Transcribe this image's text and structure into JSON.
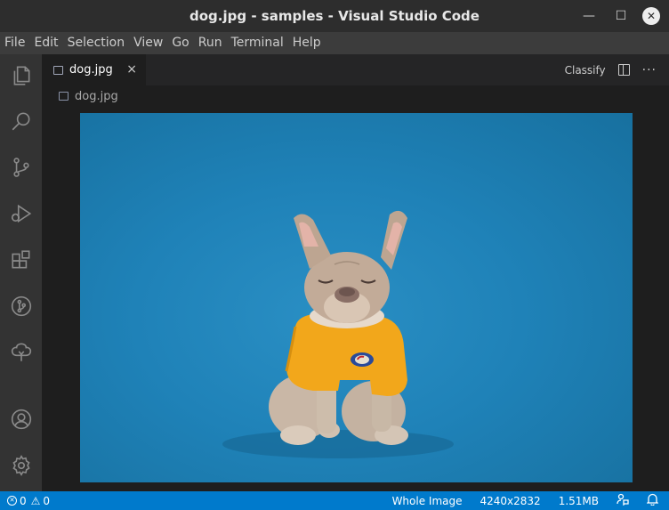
{
  "window": {
    "title": "dog.jpg - samples - Visual Studio Code"
  },
  "menu": [
    "File",
    "Edit",
    "Selection",
    "View",
    "Go",
    "Run",
    "Terminal",
    "Help"
  ],
  "activity_icons": [
    "files-icon",
    "search-icon",
    "source-control-icon",
    "run-debug-icon",
    "extensions-icon",
    "git-graph-icon",
    "tree-icon",
    "account-icon",
    "settings-gear-icon"
  ],
  "tab": {
    "label": "dog.jpg",
    "close": "×"
  },
  "tab_actions": {
    "classify_label": "Classify",
    "more": "···"
  },
  "breadcrumb": {
    "label": "dog.jpg"
  },
  "status": {
    "errors": "0",
    "warnings": "0",
    "zoom_mode": "Whole Image",
    "dimensions": "4240x2832",
    "file_size": "1.51MB"
  },
  "colors": {
    "accent": "#007acc",
    "image_background": "#1f82b8",
    "shirt": "#f2a71b"
  }
}
